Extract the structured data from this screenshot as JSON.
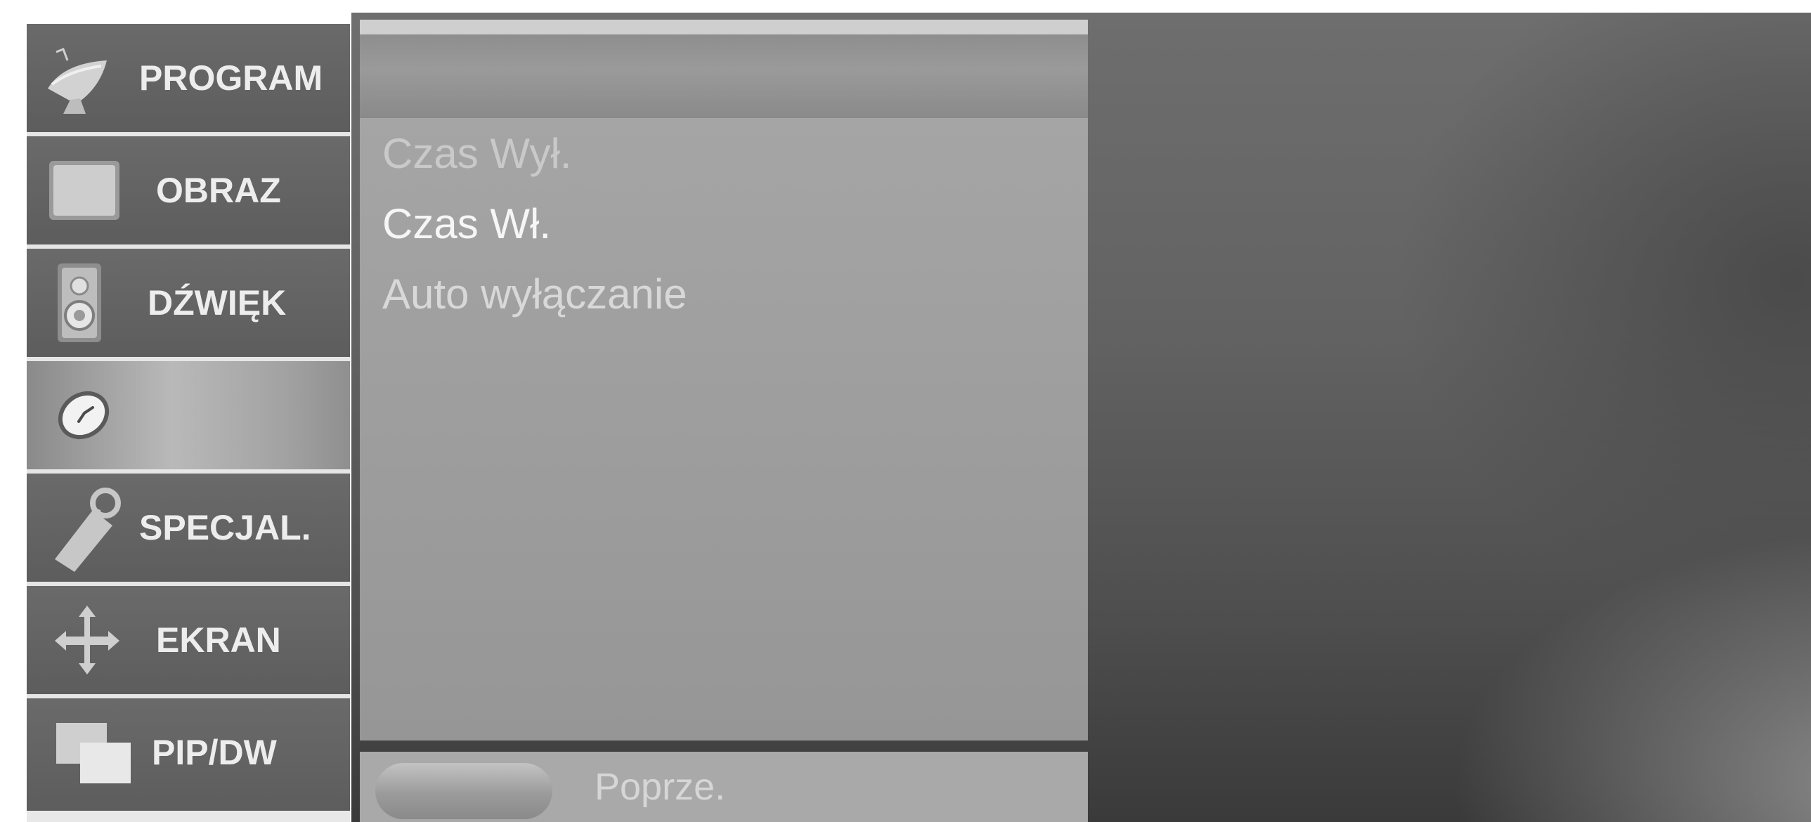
{
  "sidebar": {
    "items": [
      {
        "label": "PROGRAM",
        "icon": "satellite-dish-icon"
      },
      {
        "label": "OBRAZ",
        "icon": "picture-screen-icon"
      },
      {
        "label": "DŹWIĘK",
        "icon": "speaker-icon"
      },
      {
        "label": "",
        "icon": "clock-icon",
        "selected": true
      },
      {
        "label": "SPECJAL.",
        "icon": "key-tag-icon"
      },
      {
        "label": "EKRAN",
        "icon": "move-arrows-icon"
      },
      {
        "label": "PIP/DW",
        "icon": "pip-windows-icon"
      }
    ]
  },
  "menu": {
    "items": [
      {
        "label": "Czas Wył."
      },
      {
        "label": "Czas Wł."
      },
      {
        "label": "Auto wyłączanie"
      }
    ]
  },
  "footer": {
    "button_label": "Poprze."
  },
  "colors": {
    "sidebar_item": "#626262",
    "sidebar_selected": "#b0b0b0",
    "panel": "#a0a0a0",
    "text_bright": "#f6f6f6",
    "text_dim": "#c9c9c9"
  }
}
